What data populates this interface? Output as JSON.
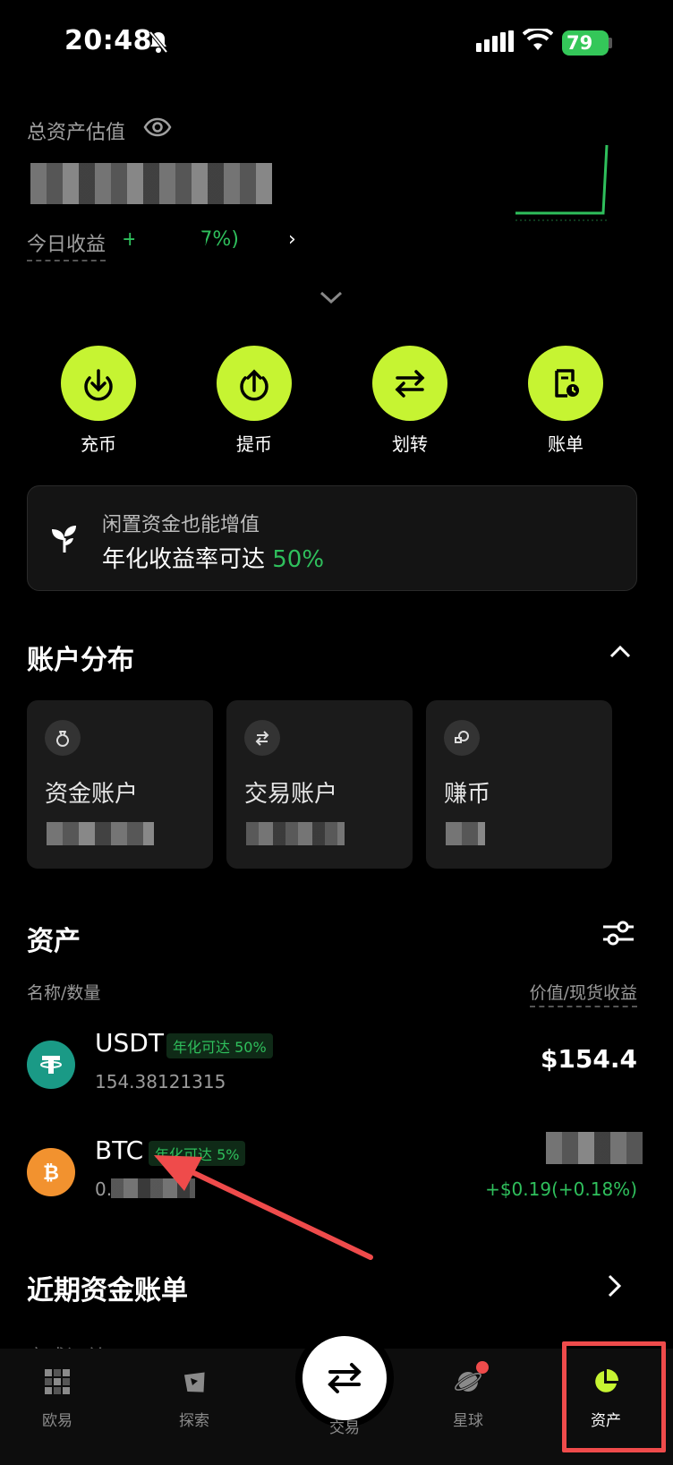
{
  "status_bar": {
    "time": "20:48",
    "battery": "79"
  },
  "header": {
    "total_label": "总资产估值",
    "today_label": "今日收益",
    "today_value": "+         (+0.47%)",
    "today_chevron": "›"
  },
  "actions": [
    {
      "label": "充币",
      "icon": "deposit-icon"
    },
    {
      "label": "提币",
      "icon": "withdraw-icon"
    },
    {
      "label": "划转",
      "icon": "transfer-icon"
    },
    {
      "label": "账单",
      "icon": "bill-icon"
    }
  ],
  "promo": {
    "line1": "闲置资金也能增值",
    "line2_prefix": "年化收益率可达 ",
    "line2_rate": "50%"
  },
  "distribution": {
    "title": "账户分布",
    "cards": [
      {
        "name": "资金账户",
        "icon": "bag-icon"
      },
      {
        "name": "交易账户",
        "icon": "swap-icon"
      },
      {
        "name": "赚币",
        "icon": "earn-icon"
      }
    ]
  },
  "assets": {
    "title": "资产",
    "col_left": "名称/数量",
    "col_right": "价值/现货收益",
    "rows": [
      {
        "symbol": "USDT",
        "tag": "年化可达 50%",
        "qty": "154.38121315",
        "value": "$154.4",
        "pnl": "",
        "color": "#1a9a86"
      },
      {
        "symbol": "BTC",
        "tag": "年化可达 5%",
        "qty": "0.",
        "value": "",
        "pnl": "+$0.19(+0.18%)",
        "color": "#f2922f"
      }
    ]
  },
  "recent": {
    "title": "近期资金账单",
    "subtitle": "完成订单"
  },
  "tabs": [
    {
      "label": "欧易",
      "icon": "okx-logo-icon"
    },
    {
      "label": "探索",
      "icon": "compass-icon"
    },
    {
      "label": "交易",
      "icon": "trade-swap-icon"
    },
    {
      "label": "星球",
      "icon": "planet-icon"
    },
    {
      "label": "资产",
      "icon": "pie-chart-icon"
    }
  ],
  "colors": {
    "accent": "#c6f432",
    "positive": "#2fbf5c",
    "annotation": "#ef4b4b"
  }
}
